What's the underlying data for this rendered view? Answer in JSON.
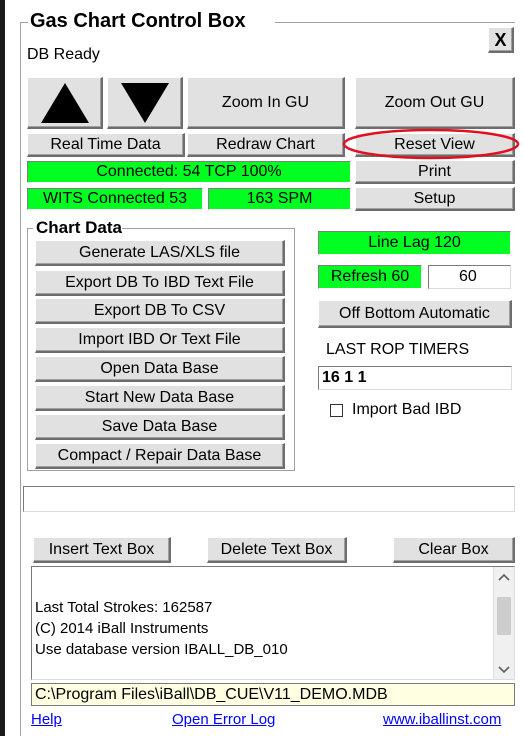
{
  "window": {
    "title": "Gas Chart Control Box",
    "close_label": "X",
    "status": "DB Ready"
  },
  "controls": {
    "zoom_in": "Zoom In GU",
    "zoom_out": "Zoom Out GU",
    "real_time": "Real Time Data",
    "redraw": "Redraw Chart",
    "reset_view": "Reset View",
    "print": "Print",
    "setup": "Setup",
    "connected": "Connected: 54 TCP 100%",
    "wits": "WITS Connected 53",
    "spm": "163 SPM"
  },
  "chart_data_group": {
    "title": "Chart Data",
    "buttons": [
      "Generate LAS/XLS file",
      "Export DB To IBD Text File",
      "Export DB To CSV",
      "Import IBD Or Text File",
      "Open Data Base",
      "Start New Data Base",
      "Save Data Base",
      "Compact / Repair Data Base"
    ]
  },
  "right_panel": {
    "line_lag": "Line Lag 120",
    "refresh": "Refresh 60",
    "refresh_value": "60",
    "off_bottom": "Off Bottom Automatic",
    "rop_label": "LAST ROP TIMERS",
    "rop_value": "16 1 1",
    "import_bad_label": "Import Bad IBD",
    "import_bad_checked": false
  },
  "text_tools": {
    "insert": "Insert Text Box",
    "delete": "Delete Text Box",
    "clear": "Clear Box"
  },
  "log": {
    "lines": [
      "Last Total Strokes: 162587",
      "(C) 2014 iBall Instruments",
      "Use database version IBALL_DB_010"
    ]
  },
  "path": "C:\\Program Files\\iBall\\DB_CUE\\V11_DEMO.MDB",
  "footer": {
    "help": "Help",
    "error_log": "Open Error Log",
    "website": "www.iballinst.com"
  },
  "colors": {
    "accent_green": "#00ff20",
    "highlight_red": "#e01020",
    "path_bg": "#ffffe1",
    "link": "#0000ff"
  }
}
